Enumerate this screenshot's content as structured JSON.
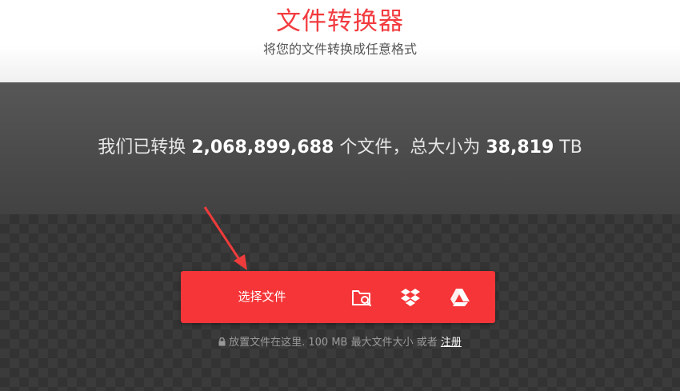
{
  "header": {
    "title": "文件转换器",
    "subtitle": "将您的文件转换成任意格式"
  },
  "stats": {
    "prefix": "我们已转换",
    "file_count": "2,068,899,688",
    "middle": "个文件，总大小为",
    "total_size": "38,819",
    "unit": "TB"
  },
  "upload": {
    "choose_label": "选择文件",
    "sources": [
      {
        "icon": "folder-search-icon"
      },
      {
        "icon": "dropbox-icon"
      },
      {
        "icon": "google-drive-icon"
      }
    ]
  },
  "note": {
    "text": "放置文件在这里. 100 MB 最大文件大小 或者",
    "link": "注册"
  },
  "colors": {
    "accent": "#f53538",
    "title_red": "#f23b3f",
    "annotation_arrow": "#ee3b3b"
  }
}
